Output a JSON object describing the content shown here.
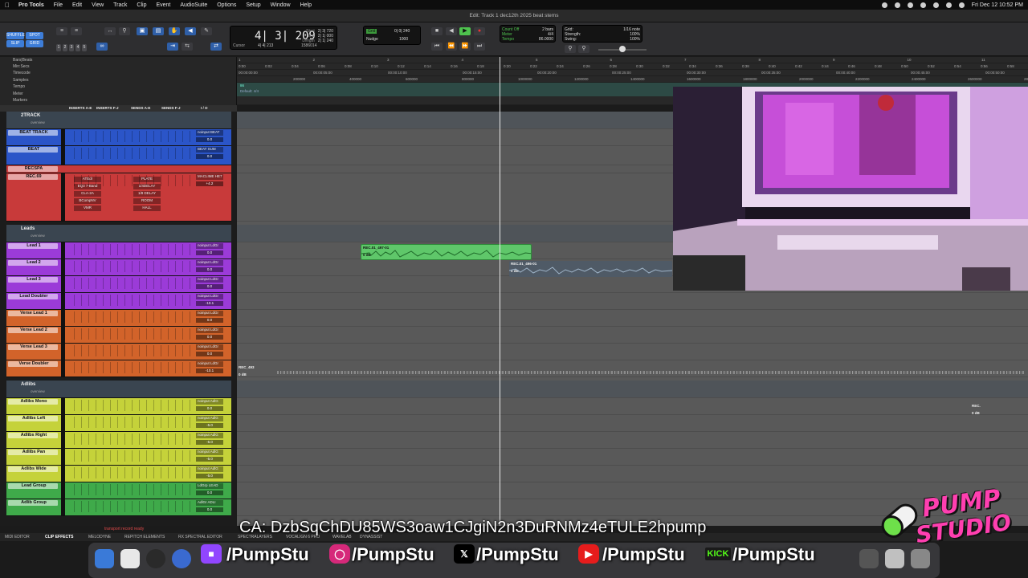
{
  "menubar": {
    "app": "Pro Tools",
    "items": [
      "File",
      "Edit",
      "View",
      "Track",
      "Clip",
      "Event",
      "AudioSuite",
      "Options",
      "Setup",
      "Window",
      "Help"
    ],
    "clock": "Fri Dec 12  10:52 PM"
  },
  "window": {
    "title": "Edit: Track 1 dec12th 2025 beat stems"
  },
  "toolbar": {
    "mode_buttons": [
      "SHUFFLE",
      "SPOT",
      "SLIP",
      "GRID"
    ],
    "zoom_presets": [
      "1",
      "2",
      "3",
      "4",
      "5"
    ],
    "counter_main": "4| 3| 209",
    "cursor_label": "Cursor",
    "cursor_value": "4| 4| 213",
    "sel_start_label": "Start",
    "sel_start": "2| 3| 720",
    "sel_end_label": "End",
    "sel_end": "2| 1| 000",
    "sel_length_label": "Length",
    "sel_length": "2| 1| 240",
    "samples": "1586014",
    "grid_label": "Grid",
    "grid_value": "0| 0| 240",
    "nudge_label": "Nudge",
    "nudge_value": "1000",
    "count_off": "Count Off",
    "count_off_value": "2 bars",
    "meter_label": "Meter",
    "meter_value": "4/4",
    "tempo_label": "Tempo",
    "tempo_value": "86.0000",
    "grid2_label": "Grid:",
    "grid2_value": "1/16 note",
    "strength_label": "Strength:",
    "strength_value": "100%",
    "swing_label": "Swing:",
    "swing_value": "100%"
  },
  "rulers": {
    "labels": [
      "Bars|Beats",
      "Min:Secs",
      "Timecode",
      "Samples",
      "Tempo",
      "Meter",
      "Markers"
    ],
    "bars": [
      "1",
      "2",
      "3",
      "4",
      "5",
      "6",
      "7",
      "8",
      "9",
      "10",
      "11"
    ],
    "mins": [
      "0:00",
      "0:02",
      "0:04",
      "0:06",
      "0:08",
      "0:10",
      "0:12",
      "0:14",
      "0:16",
      "0:18",
      "0:20",
      "0:22",
      "0:24",
      "0:26",
      "0:28",
      "0:30",
      "0:32",
      "0:34",
      "0:36",
      "0:38",
      "0:40",
      "0:42",
      "0:44",
      "0:46",
      "0:48",
      "0:50",
      "0:52",
      "0:54",
      "0:56",
      "0:58"
    ],
    "timecode": [
      "00:00:00:00",
      "00:00:05:00",
      "00:00:10:00",
      "00:00:15:00",
      "00:00:20:00",
      "00:00:25:00",
      "00:00:30:00",
      "00:00:35:00",
      "00:00:40:00",
      "00:00:45:00",
      "00:00:50:00"
    ],
    "samples": [
      "200000",
      "400000",
      "600000",
      "800000",
      "1000000",
      "1200000",
      "1400000",
      "1600000",
      "1800000",
      "2000000",
      "2200000",
      "2400000",
      "2600000",
      "2800000"
    ],
    "tempo_marker": "86",
    "meter_marker": "Default: 4/4"
  },
  "column_headers": [
    "INSERTS A-E",
    "INSERTS F-J",
    "SENDS A-E",
    "SENDS F-J",
    "I / O"
  ],
  "tracks": [
    {
      "type": "folder",
      "name": "2TRACK",
      "sub": "overview"
    },
    {
      "type": "track",
      "name": "BEAT TRACK",
      "color": "#2b55c8",
      "io": "noinput BEAT",
      "vol": "0.0"
    },
    {
      "type": "track",
      "name": "BEAT",
      "color": "#2b55c8",
      "io": "BEAT SUM",
      "vol": "0.0"
    },
    {
      "type": "aux",
      "name": "RECSPA",
      "color": "#c83a3a"
    },
    {
      "type": "track",
      "name": "REC.69",
      "color": "#c83a3a",
      "io": "MACLIME HE7",
      "vol": "+4.2",
      "inserts": [
        "ATEdr",
        "EQ3 7-Band",
        "CLA-2A",
        "BCompNV",
        "VMR"
      ],
      "sends": [
        "PLATE",
        "1/4DELAY",
        "1/8 DELAY",
        "ROOM",
        "HALL"
      ]
    },
    {
      "type": "folder",
      "name": "Leads",
      "sub": "overview"
    },
    {
      "type": "track",
      "name": "Lead 1",
      "color": "#9b3bd8",
      "io": "noinput LdGr",
      "vol": "0.0"
    },
    {
      "type": "track",
      "name": "Lead 2",
      "color": "#9b3bd8",
      "io": "noinput LdGr",
      "vol": "0.0"
    },
    {
      "type": "track",
      "name": "Lead 3",
      "color": "#9b3bd8",
      "io": "noinput LdGr",
      "vol": "0.0"
    },
    {
      "type": "track",
      "name": "Lead Doubler",
      "color": "#9b3bd8",
      "io": "noinput LdGr",
      "vol": "-10.1"
    },
    {
      "type": "track",
      "name": "Verse Lead 1",
      "color": "#d2632a",
      "io": "noinput LdGr",
      "vol": "0.0"
    },
    {
      "type": "track",
      "name": "Verse Lead 2",
      "color": "#d2632a",
      "io": "noinput LdGr",
      "vol": "0.0"
    },
    {
      "type": "track",
      "name": "Verse Lead 3",
      "color": "#d2632a",
      "io": "noinput LdGr",
      "vol": "0.0"
    },
    {
      "type": "track",
      "name": "Verse Doubler",
      "color": "#d2632a",
      "io": "noinput LdGr",
      "vol": "-10.1"
    },
    {
      "type": "folder",
      "name": "Adlibs",
      "sub": "overview"
    },
    {
      "type": "track",
      "name": "Adlibs Mono",
      "color": "#c5d23a",
      "io": "noinput AdlG",
      "vol": "0.0"
    },
    {
      "type": "track",
      "name": "Adlibs Left",
      "color": "#c5d23a",
      "io": "noinput AdlG",
      "vol": "-5.0"
    },
    {
      "type": "track",
      "name": "Adlibs Right",
      "color": "#c5d23a",
      "io": "noinput AdlG",
      "vol": "-5.0"
    },
    {
      "type": "track",
      "name": "Adlibs Pan",
      "color": "#c5d23a",
      "io": "noinput AdlG",
      "vol": "-5.0"
    },
    {
      "type": "track",
      "name": "Adlibs Wide",
      "color": "#c5d23a",
      "io": "noinput AdlG",
      "vol": "-5.0"
    },
    {
      "type": "track",
      "name": "Lead Group",
      "color": "#3faa4a",
      "io": "LdGrp LEAD",
      "vol": "0.0"
    },
    {
      "type": "track",
      "name": "Adlib Group",
      "color": "#3faa4a",
      "io": "AdlGr ADLI",
      "vol": "0.0"
    }
  ],
  "clips": [
    {
      "name": "REC.01_497-01",
      "gain": "0 dB"
    },
    {
      "name": "REC.01_496-01",
      "gain": "0 dB"
    },
    {
      "name": "REC_493",
      "gain": "0 dB"
    },
    {
      "name": "REC.",
      "gain": "0 dB"
    }
  ],
  "status_text": "transport record ready",
  "bottom_tabs": [
    "MIDI EDITOR",
    "CLIP EFFECTS",
    "MELODYNE",
    "REPITCH ELEMENTS",
    "RX SPECTRAL EDITOR",
    "SPECTRALAYERS",
    "VOCALIGN 6 PRO",
    "WAVELAB",
    "DYNASSIST"
  ],
  "overlay": {
    "ca_text": "CA: DzbSqChDU85WS3oaw1CJgiN2n3DuRNMz4eTULE2hpump",
    "twitch": "/PumpStu",
    "instagram": "/PumpStu",
    "x": "/PumpStu",
    "youtube": "/PumpStu",
    "kick_icon": "KICK",
    "kick": "/PumpStu",
    "logo_line1": "PUMP",
    "logo_line2": "STUDIO"
  },
  "colors": {
    "beat": "#2b55c8",
    "rec": "#c83a3a",
    "lead": "#9b3bd8",
    "verse": "#d2632a",
    "adlib": "#c5d23a",
    "group": "#3faa4a",
    "clip_green": "#5fc76a",
    "logo_pink": "#ff3fb0"
  }
}
